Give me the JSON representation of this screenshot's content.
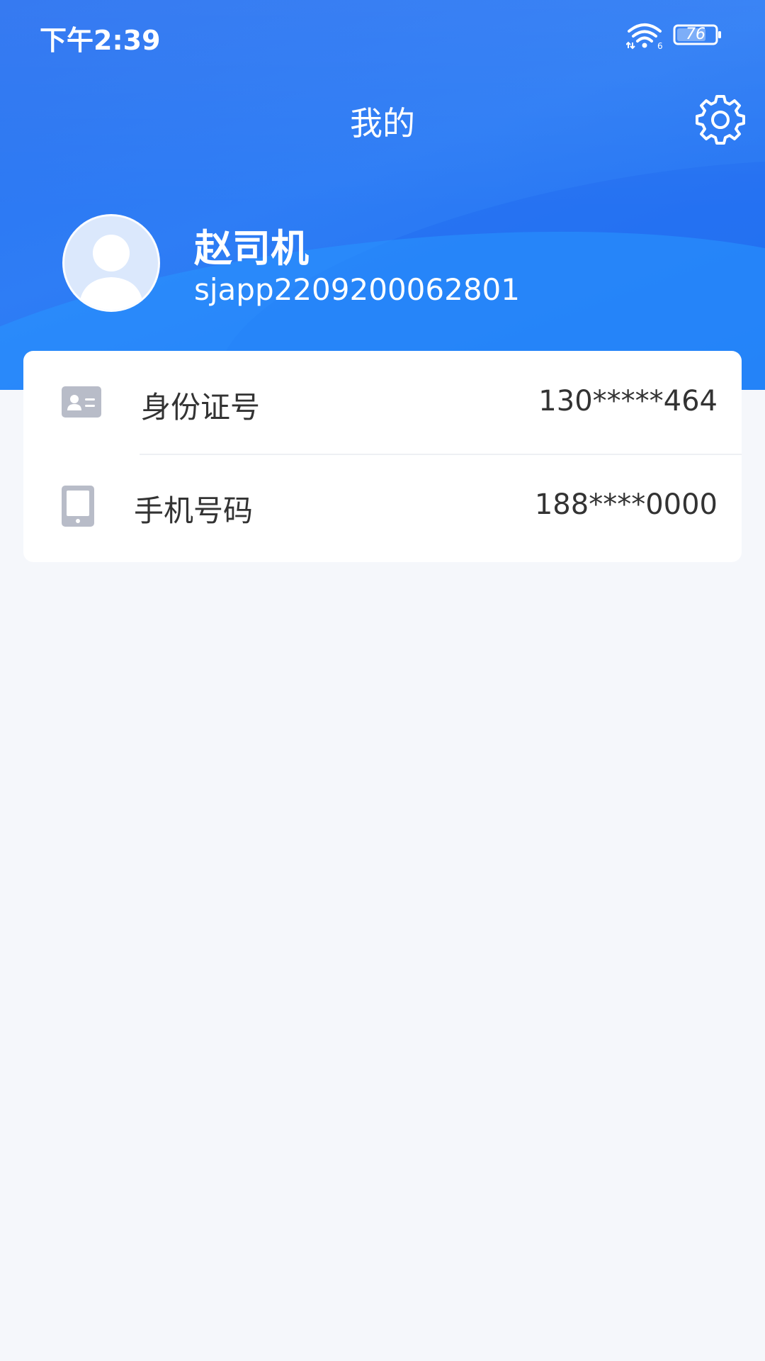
{
  "status_bar": {
    "time": "下午2:39",
    "battery_level": "76"
  },
  "header": {
    "title": "我的"
  },
  "profile": {
    "name": "赵司机",
    "account": "sjapp2209200062801"
  },
  "info_rows": [
    {
      "icon": "id-card-icon",
      "label": "身份证号",
      "value": "130*****464"
    },
    {
      "icon": "phone-icon",
      "label": "手机号码",
      "value": "188****0000"
    }
  ],
  "colors": {
    "header_blue": "#2a72f0",
    "background": "#f5f7fb",
    "icon_gray": "#b8bcc8",
    "text_dark": "#333333"
  }
}
